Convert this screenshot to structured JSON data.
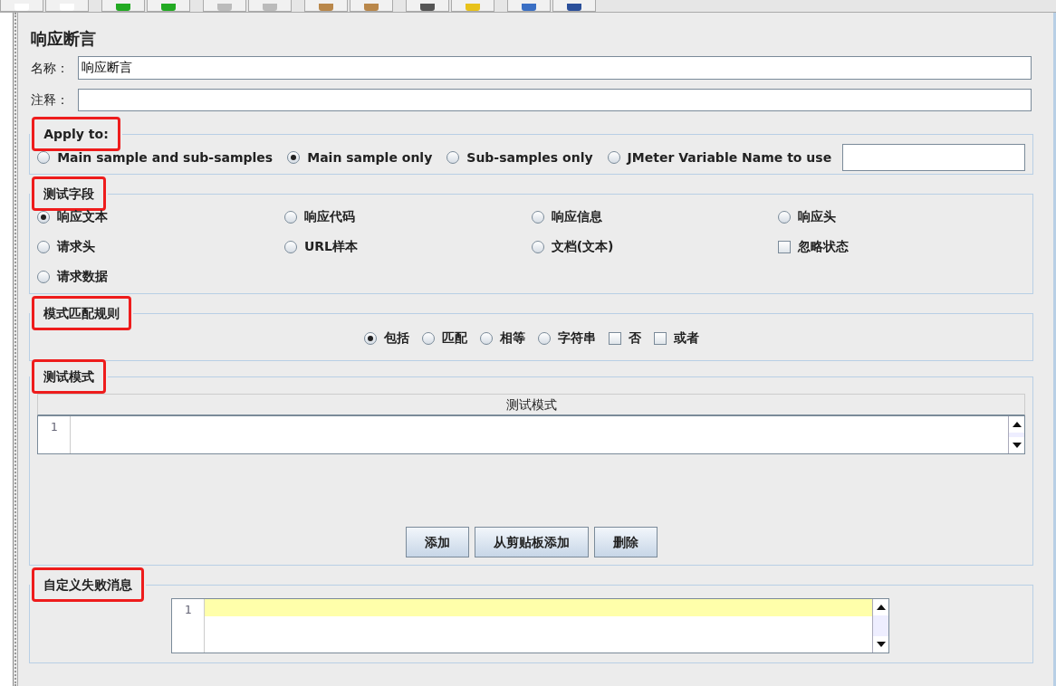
{
  "title": "响应断言",
  "name_field": {
    "label": "名称：",
    "value": "响应断言"
  },
  "comment_field": {
    "label": "注释："
  },
  "apply_to": {
    "legend": "Apply to:",
    "highlighted": true,
    "options": [
      {
        "label": "Main sample and sub-samples",
        "selected": false
      },
      {
        "label": "Main sample only",
        "selected": true
      },
      {
        "label": "Sub-samples only",
        "selected": false
      },
      {
        "label": "JMeter Variable Name to use",
        "selected": false
      }
    ]
  },
  "test_field": {
    "legend": "测试字段",
    "highlighted": true,
    "options": [
      {
        "label": "响应文本",
        "kind": "radio",
        "selected": true
      },
      {
        "label": "响应代码",
        "kind": "radio",
        "selected": false
      },
      {
        "label": "响应信息",
        "kind": "radio",
        "selected": false
      },
      {
        "label": "响应头",
        "kind": "radio",
        "selected": false
      },
      {
        "label": "请求头",
        "kind": "radio",
        "selected": false
      },
      {
        "label": "URL样本",
        "kind": "radio",
        "selected": false
      },
      {
        "label": "文档(文本)",
        "kind": "radio",
        "selected": false
      },
      {
        "label": "忽略状态",
        "kind": "checkbox",
        "selected": false
      },
      {
        "label": "请求数据",
        "kind": "radio",
        "selected": false
      }
    ]
  },
  "pattern_rules": {
    "legend": "模式匹配规则",
    "highlighted": true,
    "options": [
      {
        "label": "包括",
        "kind": "radio",
        "selected": true
      },
      {
        "label": "匹配",
        "kind": "radio",
        "selected": false
      },
      {
        "label": "相等",
        "kind": "radio",
        "selected": false
      },
      {
        "label": "字符串",
        "kind": "radio",
        "selected": false
      },
      {
        "label": "否",
        "kind": "checkbox",
        "selected": false
      },
      {
        "label": "或者",
        "kind": "checkbox",
        "selected": false
      }
    ]
  },
  "test_patterns": {
    "legend": "测试模式",
    "highlighted": true,
    "column": "测试模式",
    "line_numbers": [
      "1"
    ],
    "buttons": [
      "添加",
      "从剪贴板添加",
      "删除"
    ]
  },
  "failure_message": {
    "legend": "自定义失败消息",
    "highlighted": true,
    "line_numbers": [
      "1"
    ]
  }
}
